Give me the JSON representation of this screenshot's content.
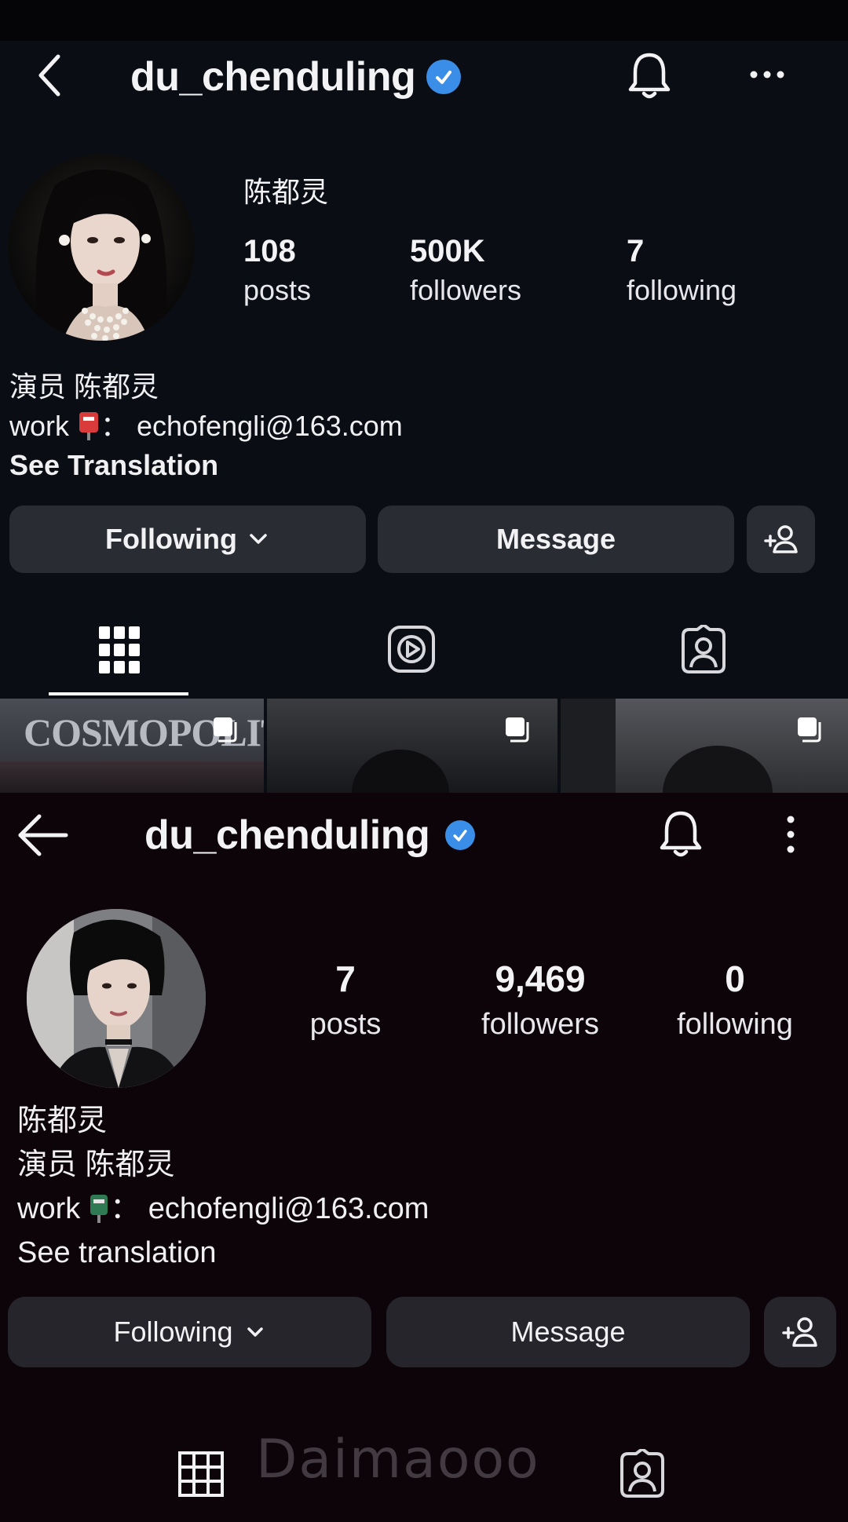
{
  "top_profile": {
    "username": "du_chenduling",
    "display_name": "陈都灵",
    "stats": {
      "posts_value": "108",
      "posts_label": "posts",
      "followers_value": "500K",
      "followers_label": "followers",
      "following_value": "7",
      "following_label": "following"
    },
    "bio": {
      "line1": "演员 陈都灵",
      "work_prefix": "work",
      "work_suffix": "：  echofengli@163.com",
      "see_translation": "See Translation"
    },
    "buttons": {
      "following": "Following",
      "message": "Message"
    },
    "grid_preview": {
      "thumb1_text": "COSMOPOLITAN"
    }
  },
  "bottom_profile": {
    "username": "du_chenduling",
    "stats": {
      "posts_value": "7",
      "posts_label": "posts",
      "followers_value": "9,469",
      "followers_label": "followers",
      "following_value": "0",
      "following_label": "following"
    },
    "bio": {
      "name_line": "陈都灵",
      "line1": "演员 陈都灵",
      "work_prefix": "work",
      "work_suffix": "：  echofengli@163.com",
      "see_translation": "See translation"
    },
    "buttons": {
      "following": "Following",
      "message": "Message"
    }
  },
  "watermark": "Daimaooo",
  "colors": {
    "verified_badge": "#3a8ee8",
    "button_bg": "#2a2c33",
    "top_bg": "#0b0d15",
    "bottom_bg": "#0d0409"
  },
  "icons": [
    "back-icon",
    "verified-icon",
    "bell-icon",
    "more-icon",
    "chevron-down-icon",
    "add-person-icon",
    "grid-icon",
    "reels-icon",
    "tagged-icon",
    "multi-post-icon"
  ]
}
